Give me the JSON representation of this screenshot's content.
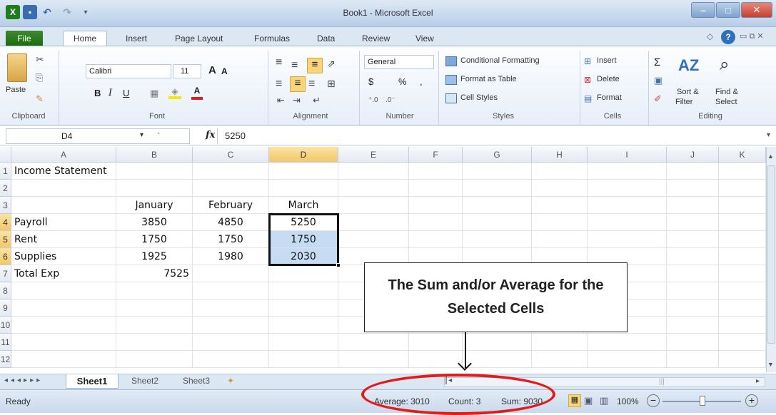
{
  "window": {
    "title": "Book1 - Microsoft Excel"
  },
  "tabs": [
    "File",
    "Home",
    "Insert",
    "Page Layout",
    "Formulas",
    "Data",
    "Review",
    "View"
  ],
  "ribbon": {
    "clipboard": {
      "label": "Clipboard",
      "paste": "Paste"
    },
    "font": {
      "label": "Font",
      "name": "Calibri",
      "size": "11"
    },
    "alignment": {
      "label": "Alignment"
    },
    "number": {
      "label": "Number",
      "format": "General",
      "dollar": "$",
      "percent": "%",
      "comma": ","
    },
    "styles": {
      "label": "Styles",
      "items": [
        "Conditional Formatting",
        "Format as Table",
        "Cell Styles"
      ]
    },
    "cells": {
      "label": "Cells",
      "items": [
        "Insert",
        "Delete",
        "Format"
      ]
    },
    "editing": {
      "label": "Editing",
      "sort": "Sort & Filter",
      "find": "Find & Select",
      "sort1": "Sort &",
      "sort2": "Filter",
      "find1": "Find &",
      "find2": "Select"
    }
  },
  "formula_bar": {
    "name_box": "D4",
    "fx": "fx",
    "value": "5250"
  },
  "columns": [
    "A",
    "B",
    "C",
    "D",
    "E",
    "F",
    "G",
    "H",
    "I",
    "J",
    "K"
  ],
  "rows": [
    "1",
    "2",
    "3",
    "4",
    "5",
    "6",
    "7",
    "8",
    "9",
    "10",
    "11",
    "12"
  ],
  "cells": {
    "A1": "Income Statement",
    "B3": "January",
    "C3": "February",
    "D3": "March",
    "A4": "Payroll",
    "B4": "3850",
    "C4": "4850",
    "D4": "5250",
    "A5": "Rent",
    "B5": "1750",
    "C5": "1750",
    "D5": "1750",
    "A6": "Supplies",
    "B6": "1925",
    "C6": "1980",
    "D6": "2030",
    "A7": "Total Exp",
    "B7": "7525"
  },
  "sheets": [
    "Sheet1",
    "Sheet2",
    "Sheet3"
  ],
  "status": {
    "ready": "Ready",
    "average": "Average: 3010",
    "count": "Count: 3",
    "sum": "Sum: 9030",
    "zoom": "100%"
  },
  "callout": {
    "text": "The Sum and/or Average for the Selected Cells"
  },
  "colors": {
    "accent": "#1f6b12",
    "selection": "#c5dcf2",
    "annotation": "#e21b1b"
  }
}
